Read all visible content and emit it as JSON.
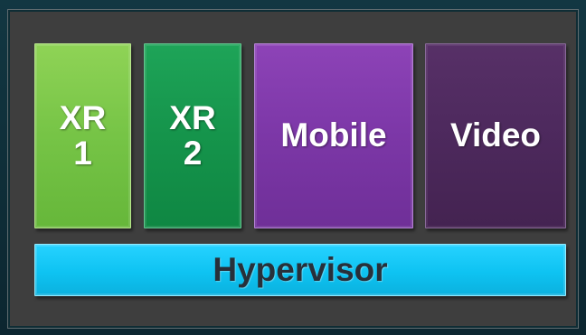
{
  "blocks": {
    "xr1": {
      "label": "XR\n1"
    },
    "xr2": {
      "label": "XR\n2"
    },
    "mobile": {
      "label": "Mobile"
    },
    "video": {
      "label": "Video"
    },
    "hypervisor": {
      "label": "Hypervisor"
    }
  },
  "colors": {
    "background": "#0f2a33",
    "frame": "#3e3e3e",
    "xr1": "#76c446",
    "xr2": "#15944b",
    "mobile": "#7c37a7",
    "video": "#4d295d",
    "hypervisor": "#0ec3f2",
    "text_light": "#ffffff",
    "text_dark": "#27303a"
  }
}
